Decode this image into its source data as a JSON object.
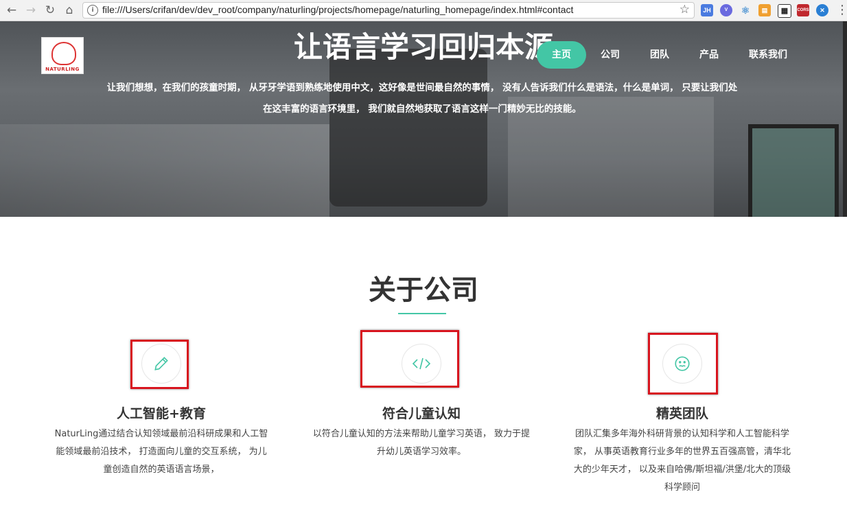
{
  "browser": {
    "url": "file:///Users/crifan/dev/dev_root/company/naturling/projects/homepage/naturling_homepage/index.html#contact",
    "extensions": [
      "JH",
      "Vue",
      "React",
      "Ext",
      "QR",
      "CORS",
      "Ext2"
    ]
  },
  "hero": {
    "title": "让语言学习回归本源",
    "logo_text": "NATURLING",
    "desc": "让我们想想，在我们的孩童时期， 从牙牙学语到熟练地使用中文，这好像是世间最自然的事情， 没有人告诉我们什么是语法，什么是单词， 只要让我们处在这丰富的语言环境里， 我们就自然地获取了语言这样一门精妙无比的技能。"
  },
  "nav": {
    "items": [
      "主页",
      "公司",
      "团队",
      "产品",
      "联系我们"
    ],
    "active_index": 0
  },
  "about": {
    "title": "关于公司",
    "features": [
      {
        "icon": "pencil-icon",
        "title": "人工智能+教育",
        "desc": "NaturLing通过结合认知领域最前沿科研成果和人工智能领域最前沿技术， 打造面向儿童的交互系统， 为儿童创造自然的英语语言场景，"
      },
      {
        "icon": "code-icon",
        "title": "符合儿童认知",
        "desc": "以符合儿童认知的方法来帮助儿童学习英语， 致力于提升幼儿英语学习效率。"
      },
      {
        "icon": "smiley-icon",
        "title": "精英团队",
        "desc": "团队汇集多年海外科研背景的认知科学和人工智能科学家， 从事英语教育行业多年的世界五百强高管，清华北大的少年天才， 以及来自哈佛/斯坦福/洪堡/北大的顶级科学顾问"
      }
    ]
  },
  "colors": {
    "accent": "#43c6a5",
    "annotation_box": "#d8141e"
  }
}
